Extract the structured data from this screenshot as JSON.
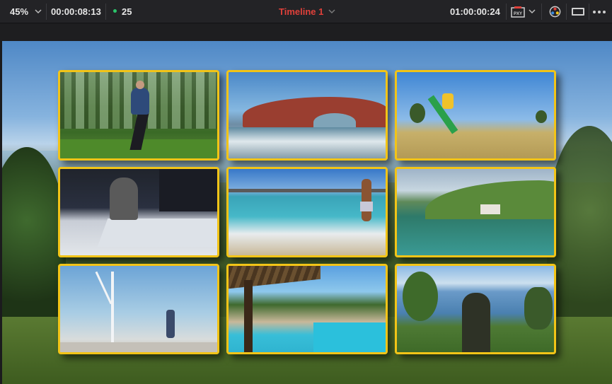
{
  "toolbar": {
    "zoom": "45%",
    "source_timecode": "00:00:08:13",
    "fps": "25",
    "timeline_name": "Timeline 1",
    "record_timecode": "01:00:00:24",
    "proxy_label": "PXY"
  },
  "colors": {
    "timeline_name": "#e0403a",
    "tile_border": "#f2c417",
    "fps_indicator": "#2bc46a"
  },
  "icons": {
    "zoom_menu": "chevron-down-icon",
    "timeline_menu": "chevron-down-icon",
    "proxy": "proxy-icon",
    "proxy_menu": "chevron-down-icon",
    "color_scope": "color-scope-icon",
    "viewer_mode": "viewer-mode-icon",
    "more": "more-options-icon"
  },
  "viewer": {
    "tiles": [
      {
        "id": 1,
        "subject": "runner-in-forest"
      },
      {
        "id": 2,
        "subject": "red-rock-arch-seascape"
      },
      {
        "id": 3,
        "subject": "high-kick-in-field"
      },
      {
        "id": 4,
        "subject": "person-at-office-desk"
      },
      {
        "id": 5,
        "subject": "man-running-on-beach"
      },
      {
        "id": 6,
        "subject": "lake-with-hills"
      },
      {
        "id": 7,
        "subject": "wind-turbine-and-walker"
      },
      {
        "id": 8,
        "subject": "resort-pool"
      },
      {
        "id": 9,
        "subject": "hiker-overlooking-lake"
      }
    ]
  }
}
